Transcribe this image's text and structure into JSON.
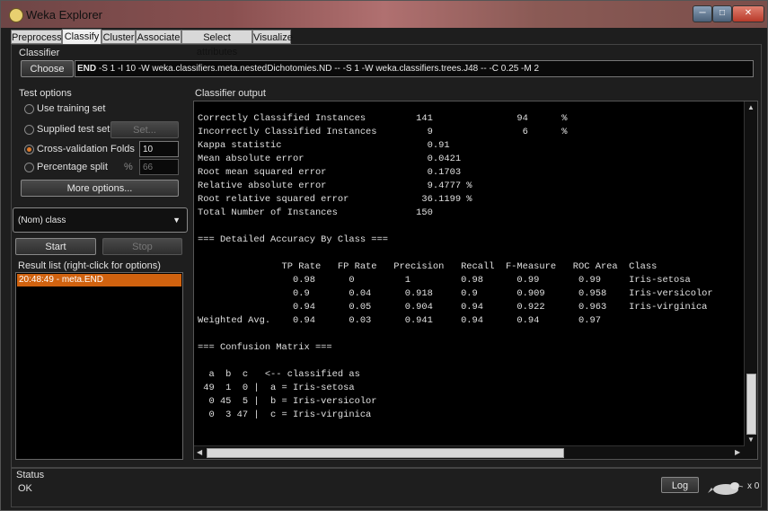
{
  "window": {
    "title": "Weka Explorer",
    "minimize": "─",
    "restore": "□",
    "close": "✕"
  },
  "tabs": [
    "Preprocess",
    "Classify",
    "Cluster",
    "Associate",
    "Select attributes",
    "Visualize"
  ],
  "classifier": {
    "label": "Classifier",
    "choose_label": "Choose",
    "name": "END",
    "options": "-S 1 -I 10 -W weka.classifiers.meta.nestedDichotomies.ND -- -S 1 -W weka.classifiers.trees.J48 -- -C 0.25 -M 2"
  },
  "test_options": {
    "label": "Test options",
    "use_training_set": "Use training set",
    "supplied_test_set": "Supplied test set",
    "set_button": "Set...",
    "cross_validation": "Cross-validation",
    "folds_label": "Folds",
    "folds_value": "10",
    "percentage_split": "Percentage split",
    "percent_label": "%",
    "percent_value": "66",
    "more_options": "More options...",
    "selected": "cross_validation"
  },
  "class_select": {
    "value": "(Nom) class"
  },
  "controls": {
    "start": "Start",
    "stop": "Stop"
  },
  "result_list": {
    "label": "Result list (right-click for options)",
    "items": [
      "20:48:49 - meta.END"
    ]
  },
  "output": {
    "label": "Classifier output",
    "lines": [
      "Correctly Classified Instances         141               94      %",
      "Incorrectly Classified Instances         9                6      %",
      "Kappa statistic                          0.91",
      "Mean absolute error                      0.0421",
      "Root mean squared error                  0.1703",
      "Relative absolute error                  9.4777 %",
      "Root relative squared error             36.1199 %",
      "Total Number of Instances              150",
      "",
      "=== Detailed Accuracy By Class ===",
      "",
      "               TP Rate   FP Rate   Precision   Recall  F-Measure   ROC Area  Class",
      "                 0.98      0         1         0.98      0.99       0.99     Iris-setosa",
      "                 0.9       0.04      0.918     0.9       0.909      0.958    Iris-versicolor",
      "                 0.94      0.05      0.904     0.94      0.922      0.963    Iris-virginica",
      "Weighted Avg.    0.94      0.03      0.941     0.94      0.94       0.97",
      "",
      "=== Confusion Matrix ===",
      "",
      "  a  b  c   <-- classified as",
      " 49  1  0 |  a = Iris-setosa",
      "  0 45  5 |  b = Iris-versicolor",
      "  0  3 47 |  c = Iris-virginica"
    ]
  },
  "status": {
    "label": "Status",
    "text": "OK",
    "log_button": "Log",
    "count": "x 0"
  },
  "colors": {
    "accent": "#d0620f",
    "output_bg": "#000000",
    "window_bg": "#1e1e1e"
  }
}
